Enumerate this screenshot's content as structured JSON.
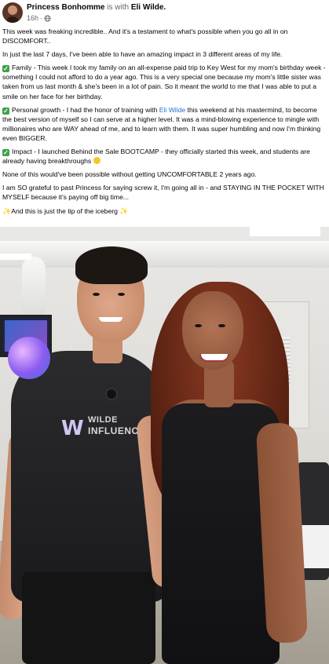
{
  "header": {
    "author": "Princess Bonhomme",
    "with_text": "is with",
    "tagged": "Eli Wilde.",
    "time": "16h",
    "privacy_icon": "globe-icon"
  },
  "post": {
    "p1": "This week was freaking incredible.. And it's a testament to what's possible when you go all in on DISCOMFORT..",
    "p2": "In just the last 7 days, I've been able to have an amazing impact in 3 different areas of my life.",
    "p3": "Family - This week I took my family on an all-expense paid trip to Key West for my mom's birthday week - something I could not afford to do a year ago. This is a very special one because my mom's little sister was taken from us last month & she's been in a lot of pain. So it meant the world to me that I was able to put a smile on her face for her birthday.",
    "p4_before": "Personal growth - I had the honor of training with ",
    "p4_link": "Eli Wilde",
    "p4_after": " this weekend at his mastermind, to become the best version of myself so I can serve at a higher level. It was a mind-blowing experience to mingle with millionaires who are WAY ahead of me, and to learn with them. It was super humbling and now I'm thinking even BIGGER.",
    "p5": "Impact - I launched Behind the Sale BOOTCAMP - they officially started this week, and students are already having breakthroughs",
    "p6": "None of this would've been possible without getting UNCOMFORTABLE 2 years ago.",
    "p7": "I am SO grateful to past Princess for saying screw it, I'm going all in - and STAYING IN THE POCKET WITH MYSELF because it's paying off big time...",
    "p8": "And this is just the tip of the iceberg",
    "check_icon": "check-box-icon",
    "sparkle_icon": "sparkles-icon",
    "emoji_icon": "smiling-face-icon"
  },
  "photo": {
    "shirt_logo_line1": "WILDE",
    "shirt_logo_line2": "INFLUENC",
    "logo_mark": "W"
  }
}
